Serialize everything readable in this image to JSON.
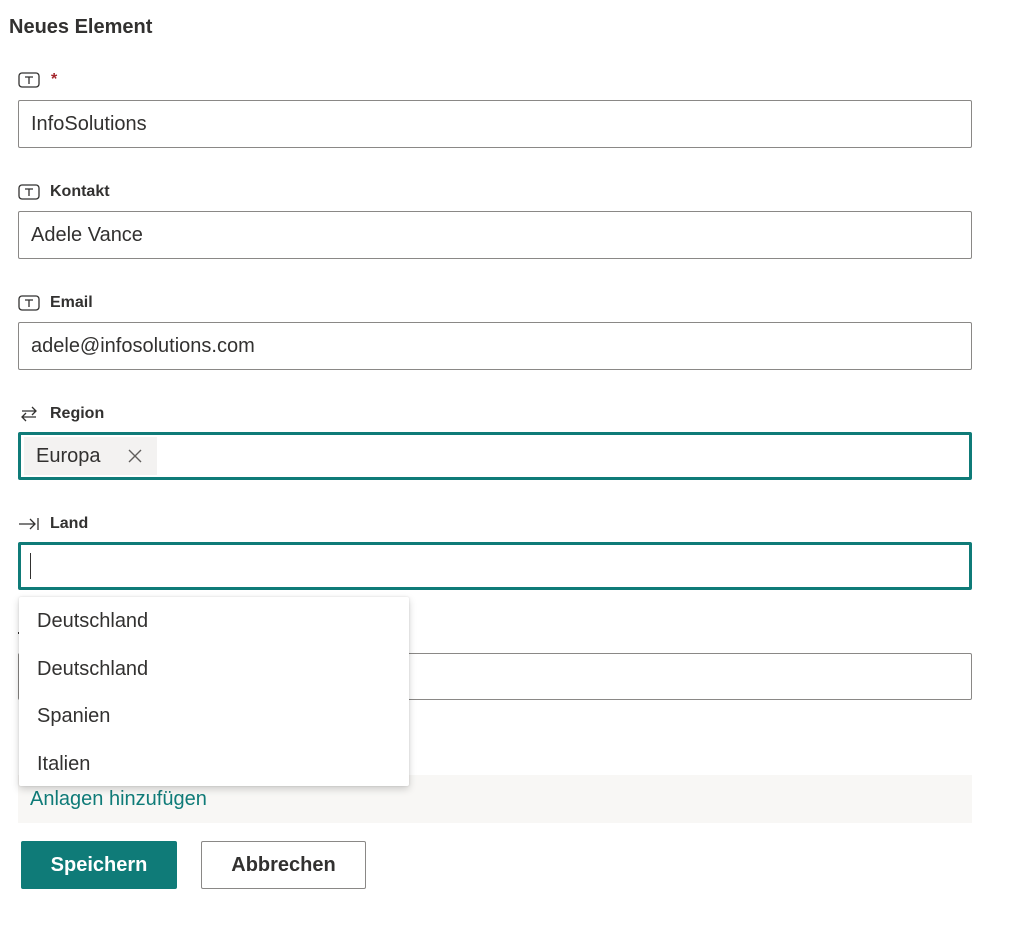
{
  "form": {
    "title": "Neues Element",
    "required_marker": "*",
    "fields": {
      "title_field": {
        "value": "InfoSolutions",
        "icon": "text-field-icon"
      },
      "kontakt": {
        "label": "Kontakt",
        "value": "Adele Vance",
        "icon": "text-field-icon"
      },
      "email": {
        "label": "Email",
        "value": "adele@infosolutions.com",
        "icon": "text-field-icon"
      },
      "region": {
        "label": "Region",
        "tag": "Europa",
        "icon": "lookup-icon"
      },
      "land": {
        "label": "Land",
        "value": "",
        "icon": "arrow-to-right-icon"
      }
    },
    "dropdown": {
      "options": [
        "Deutschland",
        "Deutschland",
        "Spanien",
        "Italien"
      ]
    },
    "attachments": {
      "link_label": "Anlagen hinzufügen"
    },
    "buttons": {
      "save": "Speichern",
      "cancel": "Abbrechen"
    }
  },
  "colors": {
    "accent": "#0f7b78",
    "required": "#a4262c",
    "text": "#323130",
    "border": "#8a8886"
  }
}
